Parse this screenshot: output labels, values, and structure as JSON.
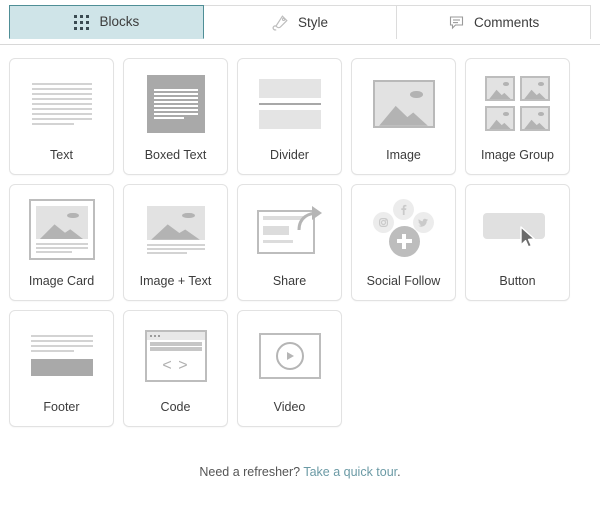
{
  "tabs": [
    {
      "label": "Blocks",
      "icon": "grid-dots-icon",
      "active": true
    },
    {
      "label": "Style",
      "icon": "paint-tag-icon",
      "active": false
    },
    {
      "label": "Comments",
      "icon": "speech-bubble-icon",
      "active": false
    }
  ],
  "blocks": [
    {
      "label": "Text",
      "art": "text"
    },
    {
      "label": "Boxed Text",
      "art": "boxed-text"
    },
    {
      "label": "Divider",
      "art": "divider"
    },
    {
      "label": "Image",
      "art": "image"
    },
    {
      "label": "Image Group",
      "art": "image-group"
    },
    {
      "label": "Image Card",
      "art": "image-card"
    },
    {
      "label": "Image + Text",
      "art": "image-text"
    },
    {
      "label": "Share",
      "art": "share"
    },
    {
      "label": "Social Follow",
      "art": "social-follow"
    },
    {
      "label": "Button",
      "art": "button"
    },
    {
      "label": "Footer",
      "art": "footer"
    },
    {
      "label": "Code",
      "art": "code"
    },
    {
      "label": "Video",
      "art": "video"
    }
  ],
  "code_glyph": "< >",
  "note": {
    "text": "Need a refresher? ",
    "link": "Take a quick tour",
    "period": "."
  },
  "colors": {
    "active_tab_bg": "#cfe4e8",
    "active_tab_border": "#4f8e96",
    "link": "#6b9aa5",
    "art_gray": "#b3b3b3",
    "art_light": "#e2e2e2"
  }
}
